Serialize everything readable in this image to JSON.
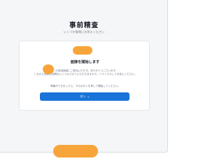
{
  "header": {
    "title": "事前精査",
    "subtitle": "いくつか質問にお答えください"
  },
  "card": {
    "heading": "面接を開始します",
    "intro_line1": "この採用面接にご参加いただき、ありがとうございます。",
    "intro_line2": "これから簡単な質問をいくつかさせていただきますので、リラックスしてお答えください。",
    "ready_note": "準備ができましたら、下のボタンを押して開始してください。",
    "next_label": "次へ",
    "next_arrow": "→"
  },
  "colors": {
    "accent": "#1a73d9",
    "redaction": "#f7a53a",
    "background": "#f5f6f8"
  }
}
